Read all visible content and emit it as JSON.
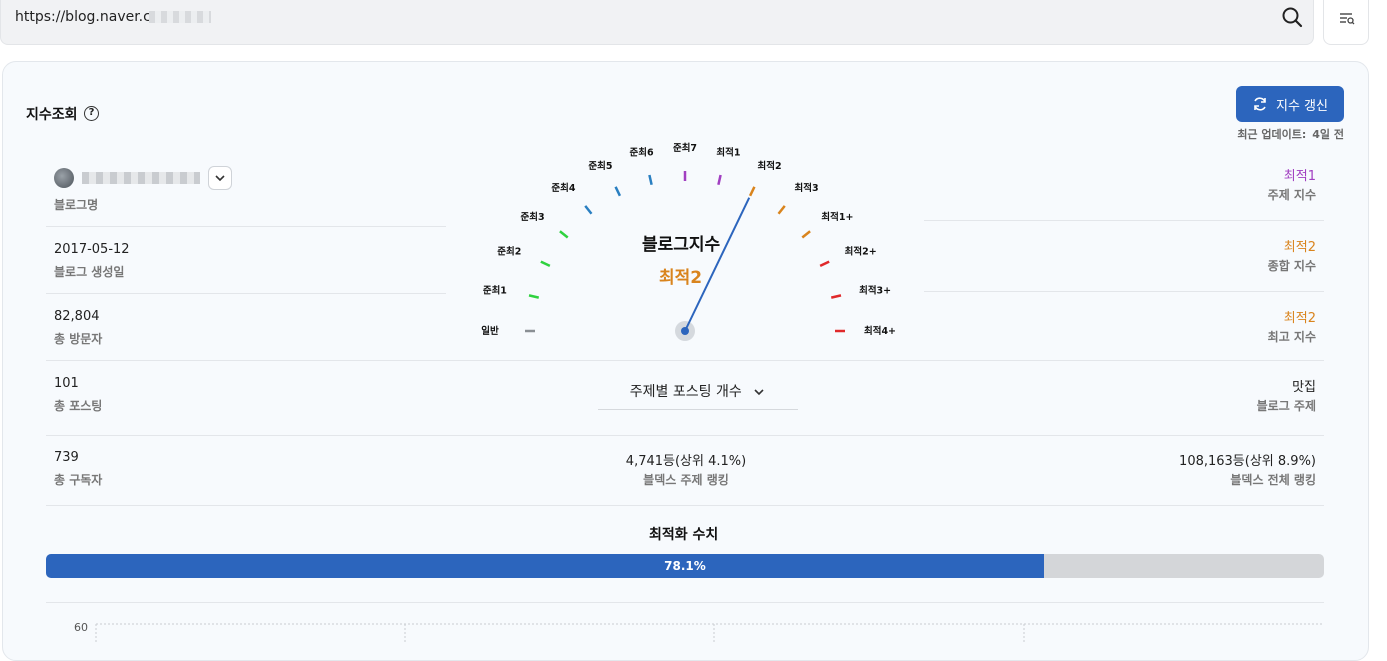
{
  "urlbar": {
    "url": "https://blog.naver.com",
    "search_icon": "search-icon",
    "filter_icon": "list-filter-icon"
  },
  "header": {
    "title": "지수조회",
    "help": "?",
    "refresh_label": "지수 갱신",
    "refresh_icon": "refresh-icon",
    "updated_label": "최근 업데이트:",
    "updated_value": "4일 전"
  },
  "left": {
    "blog_name_label": "블로그명",
    "created_value": "2017-05-12",
    "created_label": "블로그 생성일",
    "visitors_value": "82,804",
    "visitors_label": "총 방문자",
    "posts_value": "101",
    "posts_label": "총 포스팅",
    "subscribers_value": "739",
    "subscribers_label": "총 구독자"
  },
  "gauge": {
    "title": "블로그지수",
    "value": "최적2",
    "level_index": 9,
    "levels": [
      {
        "label": "일반",
        "color": "#8a8f94"
      },
      {
        "label": "준최1",
        "color": "#2fd23f"
      },
      {
        "label": "준최2",
        "color": "#2fd23f"
      },
      {
        "label": "준최3",
        "color": "#2fd23f"
      },
      {
        "label": "준최4",
        "color": "#2a7fc1"
      },
      {
        "label": "준최5",
        "color": "#2a7fc1"
      },
      {
        "label": "준최6",
        "color": "#2a7fc1"
      },
      {
        "label": "준최7",
        "color": "#a13fc1"
      },
      {
        "label": "최적1",
        "color": "#a13fc1"
      },
      {
        "label": "최적2",
        "color": "#d9841d"
      },
      {
        "label": "최적3",
        "color": "#d9841d"
      },
      {
        "label": "최적1+",
        "color": "#d9841d"
      },
      {
        "label": "최적2+",
        "color": "#e0292b"
      },
      {
        "label": "최적3+",
        "color": "#e0292b"
      },
      {
        "label": "최적4+",
        "color": "#e0292b"
      }
    ]
  },
  "right": {
    "topic_index_value": "최적1",
    "topic_index_color": "#a13fc1",
    "topic_index_label": "주제 지수",
    "overall_index_value": "최적2",
    "overall_index_color": "#d9841d",
    "overall_index_label": "종합 지수",
    "max_index_value": "최적2",
    "max_index_color": "#d9841d",
    "max_index_label": "최고 지수",
    "blog_topic_value": "맛집",
    "blog_topic_label": "블로그 주제",
    "total_rank_value": "108,163등(상위 8.9%)",
    "total_rank_label": "블덱스 전체 랭킹"
  },
  "middle": {
    "topic_select_label": "주제별 포스팅 개수",
    "topic_rank_value": "4,741등(상위 4.1%)",
    "topic_rank_label": "블덱스 주제 랭킹"
  },
  "optimization": {
    "title": "최적화 수치",
    "percent": 78.1,
    "percent_text": "78.1%"
  },
  "chart": {
    "y_tick": "60"
  }
}
